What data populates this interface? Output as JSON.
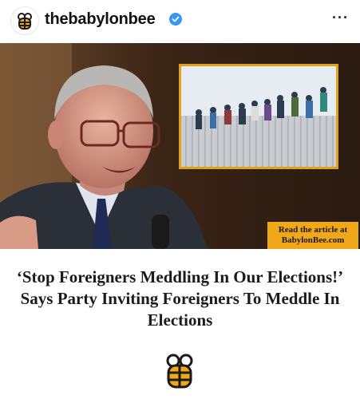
{
  "account": {
    "username": "thebabylonbee",
    "verified_icon": "verified-badge-icon",
    "more_icon": "more-options-icon",
    "more_label": "···"
  },
  "post": {
    "badge_line1": "Read the article at",
    "badge_line2": "BabylonBee.com",
    "headline": "‘Stop Foreigners Meddling In Our Elections!’ Says Party Inviting Foreigners To Meddle In Elections"
  },
  "colors": {
    "brand_gold": "#f0a81a",
    "verified_blue": "#3897f0"
  }
}
